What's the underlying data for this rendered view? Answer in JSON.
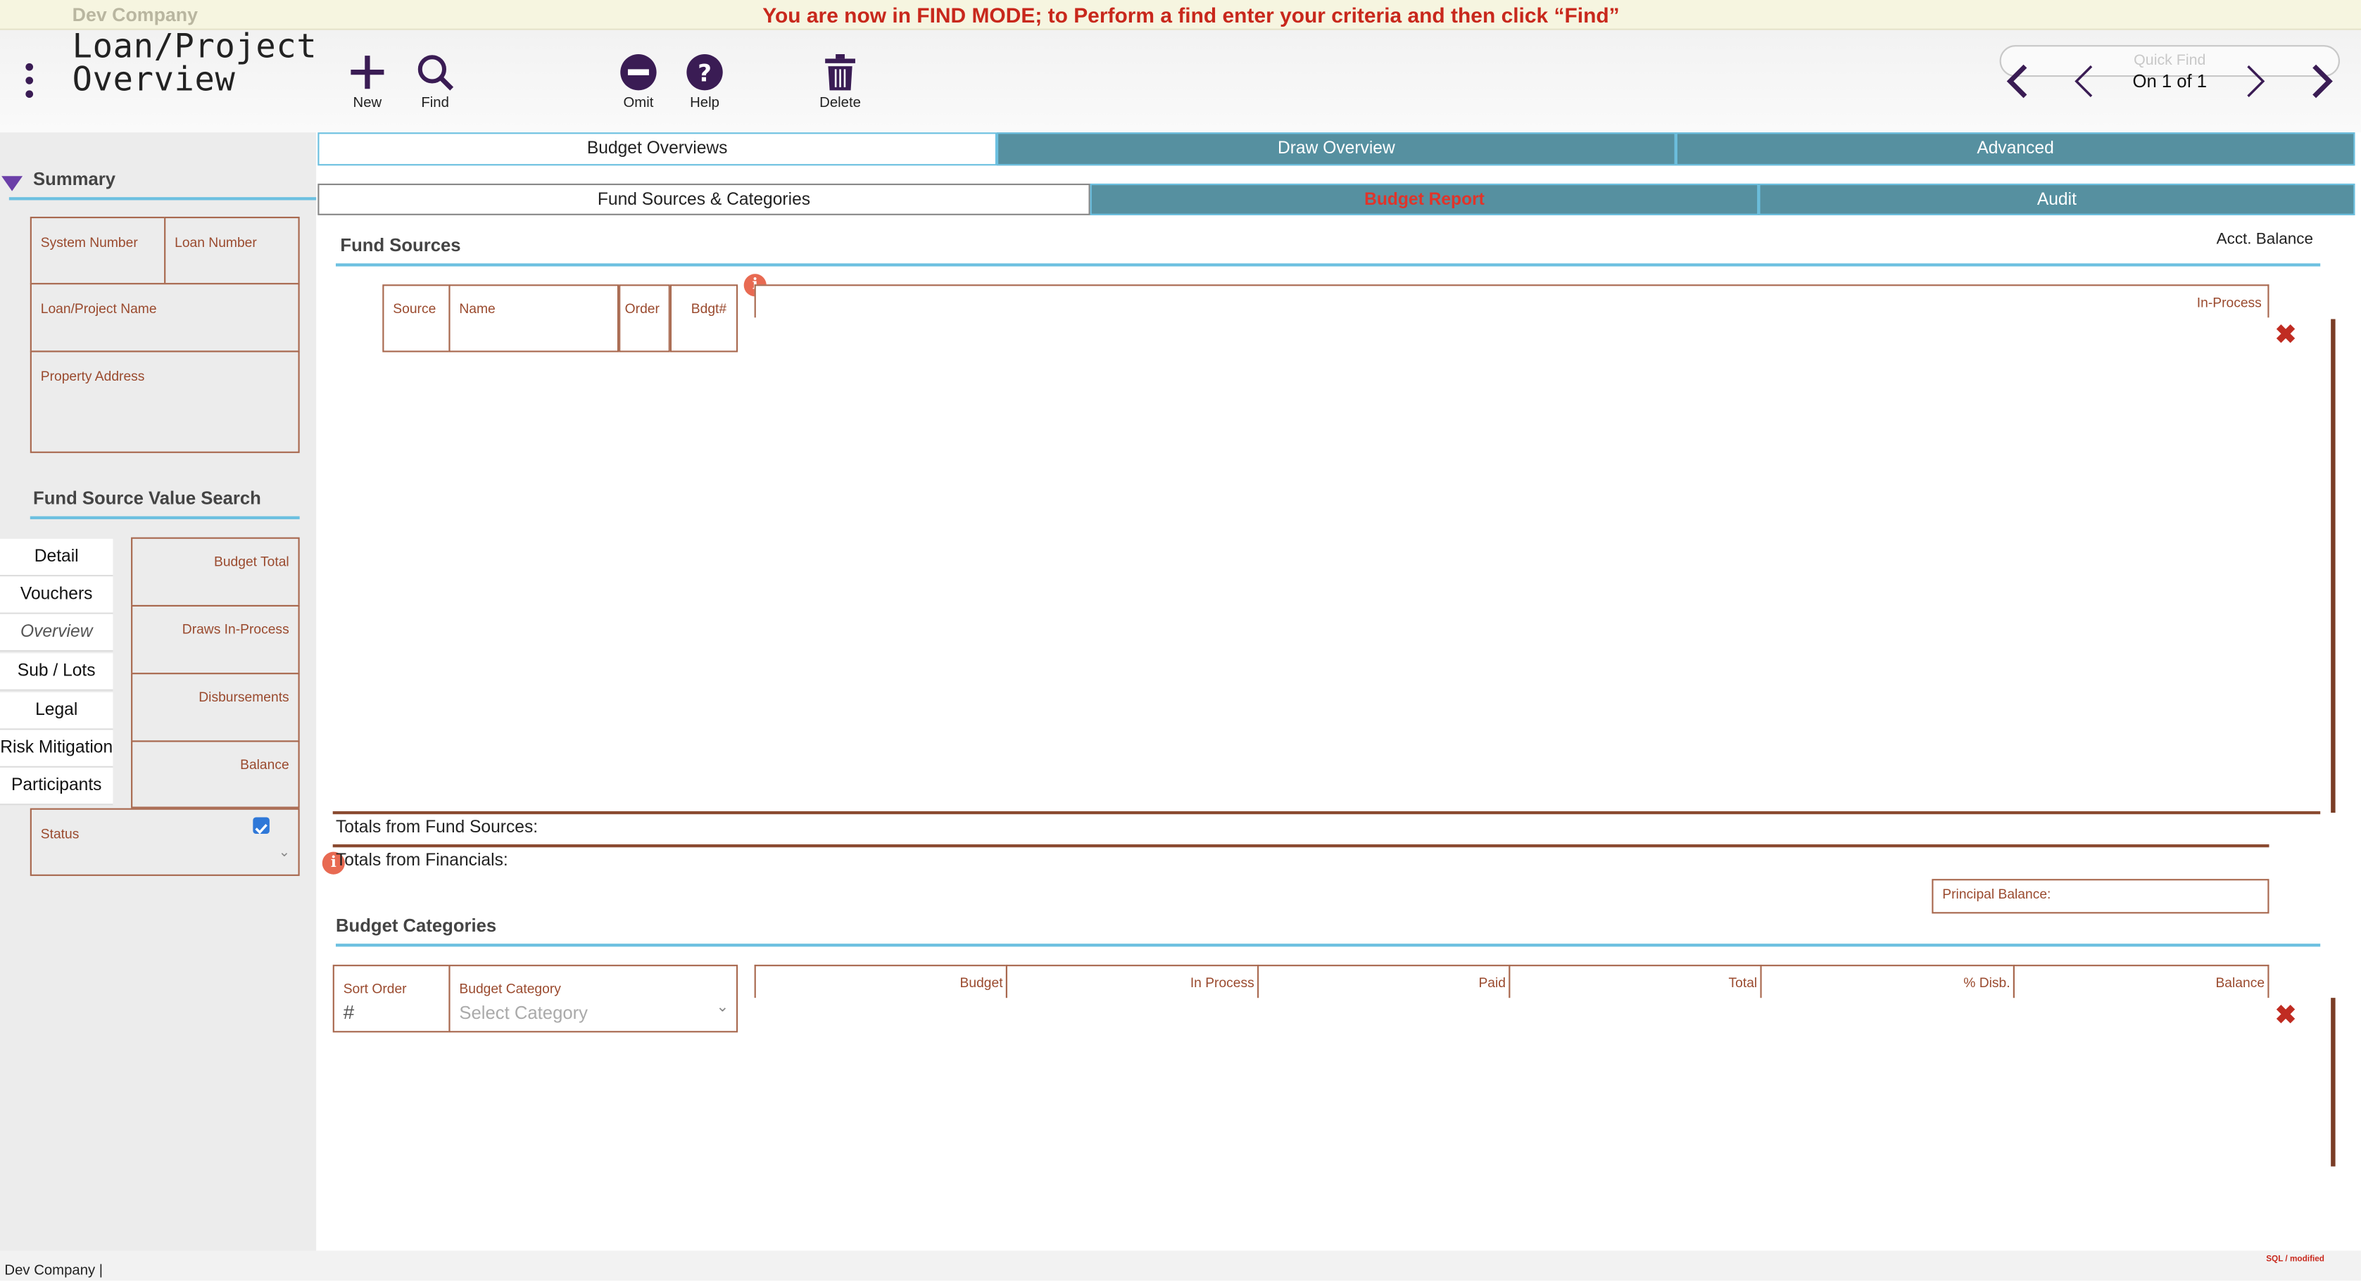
{
  "app": {
    "company": "Dev Company",
    "find_message": "You are now in FIND MODE; to Perform a find enter your criteria and then click “Find”",
    "title_line1": "Loan/Project",
    "title_line2": "Overview",
    "quick_find_placeholder": "Quick Find"
  },
  "toolbar": {
    "new_label": "New",
    "find_label": "Find",
    "omit_label": "Omit",
    "help_label": "Help",
    "delete_label": "Delete",
    "record_info": "On 1 of 1"
  },
  "summary": {
    "header": "Summary",
    "fields": {
      "system_number": "System Number",
      "loan_number": "Loan Number",
      "project_name": "Loan/Project Name",
      "property_address": "Property Address"
    }
  },
  "fund_search": {
    "header": "Fund Source Value Search",
    "nav": [
      "Detail",
      "Vouchers",
      "Overview",
      "Sub / Lots",
      "Legal",
      "Risk Mitigation",
      "Participants"
    ],
    "values": [
      "Budget Total",
      "Draws In-Process",
      "Disbursements",
      "Balance"
    ],
    "status_label": "Status",
    "status_checked": true
  },
  "tabs": {
    "top": [
      "Budget Overviews",
      "Draw Overview",
      "Advanced"
    ],
    "sub": [
      "Fund Sources & Categories",
      "Budget Report",
      "Audit"
    ]
  },
  "fund_sources": {
    "header": "Fund Sources",
    "acct_balance": "Acct. Balance",
    "columns": [
      "Source",
      "Name",
      "Order",
      "Bdgt#"
    ],
    "in_process": "In-Process",
    "totals_fund_sources": "Totals from Fund Sources:",
    "totals_financials": "Totals from Financials:",
    "principal_balance": "Principal Balance:"
  },
  "budget_categories": {
    "header": "Budget Categories",
    "sort_order_label": "Sort Order",
    "sort_order_placeholder": "#",
    "category_label": "Budget Category",
    "category_placeholder": "Select Category",
    "columns": [
      "Budget",
      "In Process",
      "Paid",
      "Total",
      "% Disb.",
      "Balance"
    ]
  },
  "footer": {
    "status": "Dev Company |",
    "sql_status": "SQL / modified"
  },
  "colors": {
    "accent": "#5690a0",
    "field_border": "#a8684e",
    "label": "#9a4a2e",
    "alert": "#c8281c",
    "icon": "#3a1c54"
  }
}
